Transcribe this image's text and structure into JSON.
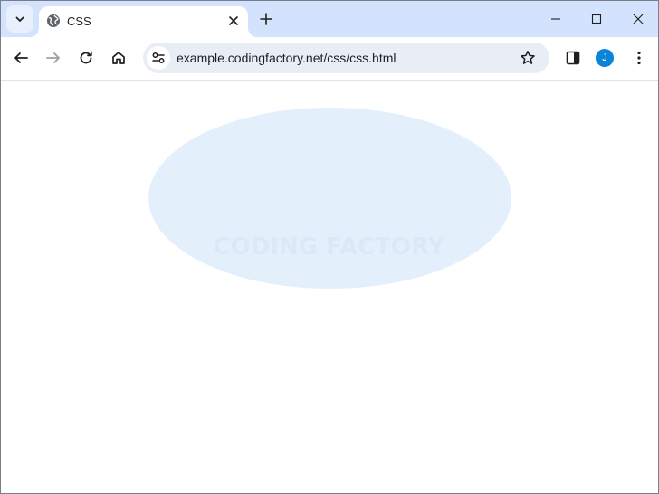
{
  "browser": {
    "tab": {
      "title": "CSS",
      "favicon": "globe-icon"
    },
    "new_tab_icon": "plus-icon",
    "window_controls": [
      "minimize-icon",
      "maximize-icon",
      "close-icon"
    ]
  },
  "toolbar": {
    "url": "example.codingfactory.net/css/css.html",
    "profile_initial": "J",
    "profile_color": "#0b84d8"
  },
  "page": {
    "ellipse_text": "CODING FACTORY",
    "ellipse_color": "#e3f0fc",
    "text_color": "#d9e9f8"
  }
}
